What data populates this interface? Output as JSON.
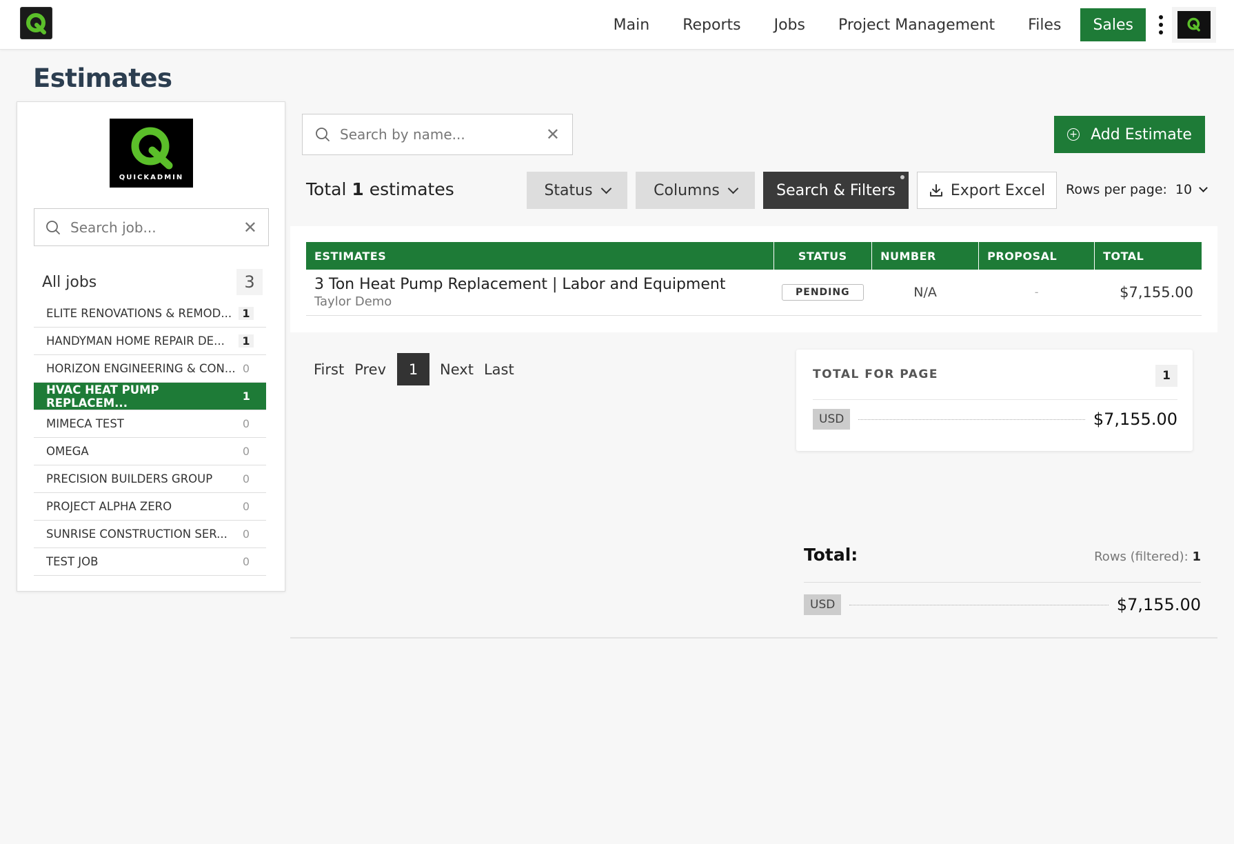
{
  "nav": {
    "items": [
      "Main",
      "Reports",
      "Jobs",
      "Project Management",
      "Files"
    ],
    "active": "Sales"
  },
  "page_title": "Estimates",
  "sidebar": {
    "logo_text": "QUICKADMIN",
    "search_placeholder": "Search job...",
    "all_jobs_label": "All jobs",
    "all_jobs_count": "3",
    "jobs": [
      {
        "name": "ELITE RENOVATIONS & REMOD...",
        "count": "1"
      },
      {
        "name": "HANDYMAN HOME REPAIR DE...",
        "count": "1"
      },
      {
        "name": "HORIZON ENGINEERING & CON...",
        "count": "0"
      },
      {
        "name": "HVAC HEAT PUMP REPLACEM...",
        "count": "1",
        "active": true
      },
      {
        "name": "MIMECA TEST",
        "count": "0"
      },
      {
        "name": "OMEGA",
        "count": "0"
      },
      {
        "name": "PRECISION BUILDERS GROUP",
        "count": "0"
      },
      {
        "name": "PROJECT ALPHA ZERO",
        "count": "0"
      },
      {
        "name": "SUNRISE CONSTRUCTION SER...",
        "count": "0"
      },
      {
        "name": "TEST JOB",
        "count": "0"
      }
    ]
  },
  "main": {
    "search_placeholder": "Search by name...",
    "add_button": "Add Estimate",
    "total_prefix": "Total",
    "total_count": "1",
    "total_suffix": "estimates",
    "status_button": "Status",
    "columns_button": "Columns",
    "filters_button": "Search & Filters",
    "export_button": "Export Excel",
    "rows_per_page_label": "Rows per page:",
    "rows_per_page_value": "10"
  },
  "table": {
    "headers": [
      "ESTIMATES",
      "STATUS",
      "NUMBER",
      "PROPOSAL",
      "TOTAL"
    ],
    "rows": [
      {
        "name": "3 Ton Heat Pump Replacement | Labor and Equipment",
        "client": "Taylor Demo",
        "status": "PENDING",
        "number": "N/A",
        "proposal": "-",
        "total": "$7,155.00"
      }
    ]
  },
  "pagination": {
    "first": "First",
    "prev": "Prev",
    "current": "1",
    "next": "Next",
    "last": "Last"
  },
  "page_total": {
    "title": "TOTAL FOR PAGE",
    "count": "1",
    "currency": "USD",
    "amount": "$7,155.00"
  },
  "grand_total": {
    "label": "Total:",
    "rows_label": "Rows (filtered):",
    "rows_value": "1",
    "currency": "USD",
    "amount": "$7,155.00"
  },
  "colors": {
    "brand_green": "#1e7b37",
    "dark_button": "#3a3a3a"
  }
}
